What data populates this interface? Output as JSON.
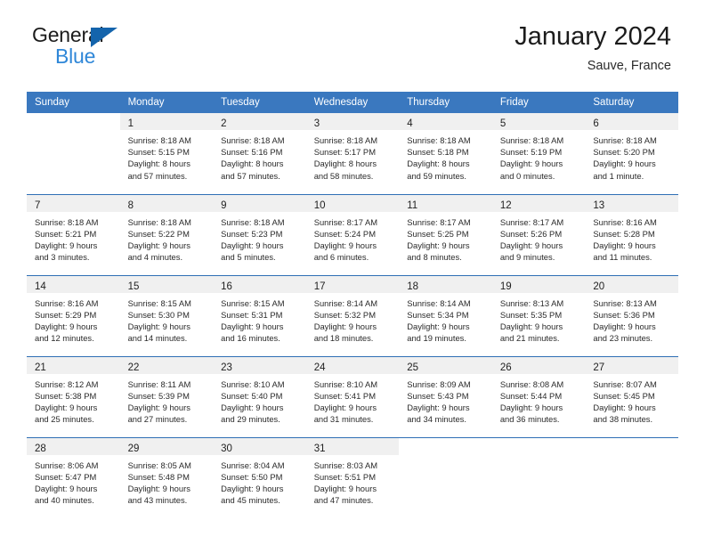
{
  "brand": {
    "line1": "General",
    "line2": "Blue",
    "triangle_icon": "triangle-logo-icon",
    "color_dark": "#1c1c1c",
    "color_blue": "#2f87d8",
    "color_triangle": "#1464ac"
  },
  "header": {
    "title": "January 2024",
    "subtitle": "Sauve, France"
  },
  "theme": {
    "header_bg": "#3a78bf",
    "header_text": "#ffffff",
    "daynum_band": "#f0f0f0",
    "row_divider": "#2f6fb5"
  },
  "calendar": {
    "weekday_headers": [
      "Sunday",
      "Monday",
      "Tuesday",
      "Wednesday",
      "Thursday",
      "Friday",
      "Saturday"
    ],
    "weeks": [
      [
        {
          "day": "",
          "sunrise": "",
          "sunset": "",
          "daylight_line1": "",
          "daylight_line2": ""
        },
        {
          "day": "1",
          "sunrise": "Sunrise: 8:18 AM",
          "sunset": "Sunset: 5:15 PM",
          "daylight_line1": "Daylight: 8 hours",
          "daylight_line2": "and 57 minutes."
        },
        {
          "day": "2",
          "sunrise": "Sunrise: 8:18 AM",
          "sunset": "Sunset: 5:16 PM",
          "daylight_line1": "Daylight: 8 hours",
          "daylight_line2": "and 57 minutes."
        },
        {
          "day": "3",
          "sunrise": "Sunrise: 8:18 AM",
          "sunset": "Sunset: 5:17 PM",
          "daylight_line1": "Daylight: 8 hours",
          "daylight_line2": "and 58 minutes."
        },
        {
          "day": "4",
          "sunrise": "Sunrise: 8:18 AM",
          "sunset": "Sunset: 5:18 PM",
          "daylight_line1": "Daylight: 8 hours",
          "daylight_line2": "and 59 minutes."
        },
        {
          "day": "5",
          "sunrise": "Sunrise: 8:18 AM",
          "sunset": "Sunset: 5:19 PM",
          "daylight_line1": "Daylight: 9 hours",
          "daylight_line2": "and 0 minutes."
        },
        {
          "day": "6",
          "sunrise": "Sunrise: 8:18 AM",
          "sunset": "Sunset: 5:20 PM",
          "daylight_line1": "Daylight: 9 hours",
          "daylight_line2": "and 1 minute."
        }
      ],
      [
        {
          "day": "7",
          "sunrise": "Sunrise: 8:18 AM",
          "sunset": "Sunset: 5:21 PM",
          "daylight_line1": "Daylight: 9 hours",
          "daylight_line2": "and 3 minutes."
        },
        {
          "day": "8",
          "sunrise": "Sunrise: 8:18 AM",
          "sunset": "Sunset: 5:22 PM",
          "daylight_line1": "Daylight: 9 hours",
          "daylight_line2": "and 4 minutes."
        },
        {
          "day": "9",
          "sunrise": "Sunrise: 8:18 AM",
          "sunset": "Sunset: 5:23 PM",
          "daylight_line1": "Daylight: 9 hours",
          "daylight_line2": "and 5 minutes."
        },
        {
          "day": "10",
          "sunrise": "Sunrise: 8:17 AM",
          "sunset": "Sunset: 5:24 PM",
          "daylight_line1": "Daylight: 9 hours",
          "daylight_line2": "and 6 minutes."
        },
        {
          "day": "11",
          "sunrise": "Sunrise: 8:17 AM",
          "sunset": "Sunset: 5:25 PM",
          "daylight_line1": "Daylight: 9 hours",
          "daylight_line2": "and 8 minutes."
        },
        {
          "day": "12",
          "sunrise": "Sunrise: 8:17 AM",
          "sunset": "Sunset: 5:26 PM",
          "daylight_line1": "Daylight: 9 hours",
          "daylight_line2": "and 9 minutes."
        },
        {
          "day": "13",
          "sunrise": "Sunrise: 8:16 AM",
          "sunset": "Sunset: 5:28 PM",
          "daylight_line1": "Daylight: 9 hours",
          "daylight_line2": "and 11 minutes."
        }
      ],
      [
        {
          "day": "14",
          "sunrise": "Sunrise: 8:16 AM",
          "sunset": "Sunset: 5:29 PM",
          "daylight_line1": "Daylight: 9 hours",
          "daylight_line2": "and 12 minutes."
        },
        {
          "day": "15",
          "sunrise": "Sunrise: 8:15 AM",
          "sunset": "Sunset: 5:30 PM",
          "daylight_line1": "Daylight: 9 hours",
          "daylight_line2": "and 14 minutes."
        },
        {
          "day": "16",
          "sunrise": "Sunrise: 8:15 AM",
          "sunset": "Sunset: 5:31 PM",
          "daylight_line1": "Daylight: 9 hours",
          "daylight_line2": "and 16 minutes."
        },
        {
          "day": "17",
          "sunrise": "Sunrise: 8:14 AM",
          "sunset": "Sunset: 5:32 PM",
          "daylight_line1": "Daylight: 9 hours",
          "daylight_line2": "and 18 minutes."
        },
        {
          "day": "18",
          "sunrise": "Sunrise: 8:14 AM",
          "sunset": "Sunset: 5:34 PM",
          "daylight_line1": "Daylight: 9 hours",
          "daylight_line2": "and 19 minutes."
        },
        {
          "day": "19",
          "sunrise": "Sunrise: 8:13 AM",
          "sunset": "Sunset: 5:35 PM",
          "daylight_line1": "Daylight: 9 hours",
          "daylight_line2": "and 21 minutes."
        },
        {
          "day": "20",
          "sunrise": "Sunrise: 8:13 AM",
          "sunset": "Sunset: 5:36 PM",
          "daylight_line1": "Daylight: 9 hours",
          "daylight_line2": "and 23 minutes."
        }
      ],
      [
        {
          "day": "21",
          "sunrise": "Sunrise: 8:12 AM",
          "sunset": "Sunset: 5:38 PM",
          "daylight_line1": "Daylight: 9 hours",
          "daylight_line2": "and 25 minutes."
        },
        {
          "day": "22",
          "sunrise": "Sunrise: 8:11 AM",
          "sunset": "Sunset: 5:39 PM",
          "daylight_line1": "Daylight: 9 hours",
          "daylight_line2": "and 27 minutes."
        },
        {
          "day": "23",
          "sunrise": "Sunrise: 8:10 AM",
          "sunset": "Sunset: 5:40 PM",
          "daylight_line1": "Daylight: 9 hours",
          "daylight_line2": "and 29 minutes."
        },
        {
          "day": "24",
          "sunrise": "Sunrise: 8:10 AM",
          "sunset": "Sunset: 5:41 PM",
          "daylight_line1": "Daylight: 9 hours",
          "daylight_line2": "and 31 minutes."
        },
        {
          "day": "25",
          "sunrise": "Sunrise: 8:09 AM",
          "sunset": "Sunset: 5:43 PM",
          "daylight_line1": "Daylight: 9 hours",
          "daylight_line2": "and 34 minutes."
        },
        {
          "day": "26",
          "sunrise": "Sunrise: 8:08 AM",
          "sunset": "Sunset: 5:44 PM",
          "daylight_line1": "Daylight: 9 hours",
          "daylight_line2": "and 36 minutes."
        },
        {
          "day": "27",
          "sunrise": "Sunrise: 8:07 AM",
          "sunset": "Sunset: 5:45 PM",
          "daylight_line1": "Daylight: 9 hours",
          "daylight_line2": "and 38 minutes."
        }
      ],
      [
        {
          "day": "28",
          "sunrise": "Sunrise: 8:06 AM",
          "sunset": "Sunset: 5:47 PM",
          "daylight_line1": "Daylight: 9 hours",
          "daylight_line2": "and 40 minutes."
        },
        {
          "day": "29",
          "sunrise": "Sunrise: 8:05 AM",
          "sunset": "Sunset: 5:48 PM",
          "daylight_line1": "Daylight: 9 hours",
          "daylight_line2": "and 43 minutes."
        },
        {
          "day": "30",
          "sunrise": "Sunrise: 8:04 AM",
          "sunset": "Sunset: 5:50 PM",
          "daylight_line1": "Daylight: 9 hours",
          "daylight_line2": "and 45 minutes."
        },
        {
          "day": "31",
          "sunrise": "Sunrise: 8:03 AM",
          "sunset": "Sunset: 5:51 PM",
          "daylight_line1": "Daylight: 9 hours",
          "daylight_line2": "and 47 minutes."
        },
        {
          "day": "",
          "sunrise": "",
          "sunset": "",
          "daylight_line1": "",
          "daylight_line2": ""
        },
        {
          "day": "",
          "sunrise": "",
          "sunset": "",
          "daylight_line1": "",
          "daylight_line2": ""
        },
        {
          "day": "",
          "sunrise": "",
          "sunset": "",
          "daylight_line1": "",
          "daylight_line2": ""
        }
      ]
    ]
  }
}
